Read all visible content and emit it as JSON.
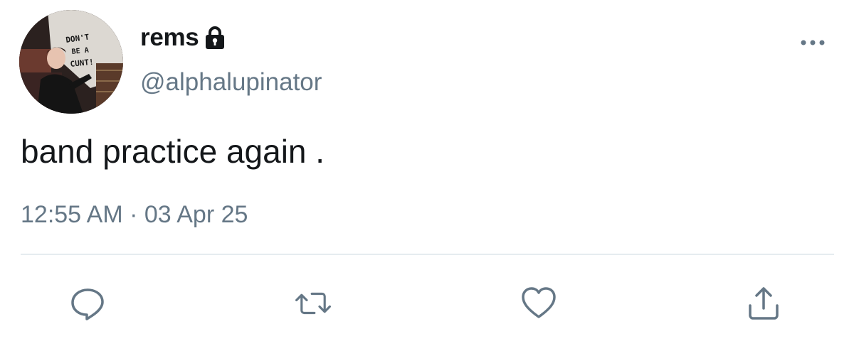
{
  "tweet": {
    "display_name": "rems",
    "handle": "@alphalupinator",
    "text": "band practice again .",
    "timestamp": "12:55 AM · 03 Apr 25",
    "avatar_wall_text": [
      "DON'T",
      "BE A",
      "CUNT!"
    ]
  },
  "icons": {
    "lock": "lock-icon",
    "more": "more-horizontal-icon",
    "reply": "reply-icon",
    "retweet": "retweet-icon",
    "like": "heart-icon",
    "share": "share-icon"
  },
  "colors": {
    "text_primary": "#14171a",
    "text_secondary": "#657786",
    "icon": "#657786",
    "divider": "#e6ecf0"
  }
}
